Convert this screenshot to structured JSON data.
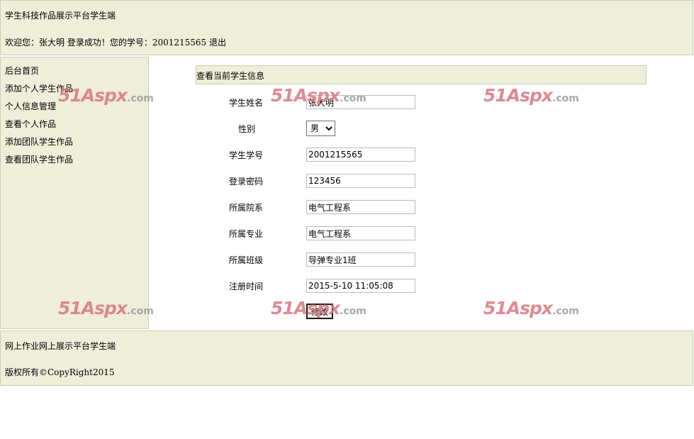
{
  "header": {
    "title": "学生科技作品展示平台学生端",
    "welcome": "欢迎您：张大明 登录成功！您的学号：2001215565 退出"
  },
  "sidebar": {
    "items": [
      {
        "label": "后台首页"
      },
      {
        "label": "添加个人学生作品"
      },
      {
        "label": "个人信息管理"
      },
      {
        "label": "查看个人作品"
      },
      {
        "label": "添加团队学生作品"
      },
      {
        "label": "查看团队学生作品"
      }
    ]
  },
  "section": {
    "title": "查看当前学生信息"
  },
  "form": {
    "name_label": "学生姓名",
    "name_value": "张大明",
    "gender_label": "性别",
    "gender_value": "男",
    "id_label": "学生学号",
    "id_value": "2001215565",
    "password_label": "登录密码",
    "password_value": "123456",
    "dept_label": "所属院系",
    "dept_value": "电气工程系",
    "major_label": "所属专业",
    "major_value": "电气工程系",
    "class_label": "所属班级",
    "class_value": "导弹专业1班",
    "regtime_label": "注册时间",
    "regtime_value": "2015-5-10 11:05:08",
    "submit_label": "修改"
  },
  "footer": {
    "line1": "网上作业网上展示平台学生端",
    "line2": "版权所有©CopyRight2015"
  },
  "watermark": {
    "main": "51Aspx",
    "suffix": ".com"
  },
  "colors": {
    "panel_bg": "#eeeed9",
    "panel_border": "#c9cfb0",
    "watermark": "#d9777e"
  }
}
